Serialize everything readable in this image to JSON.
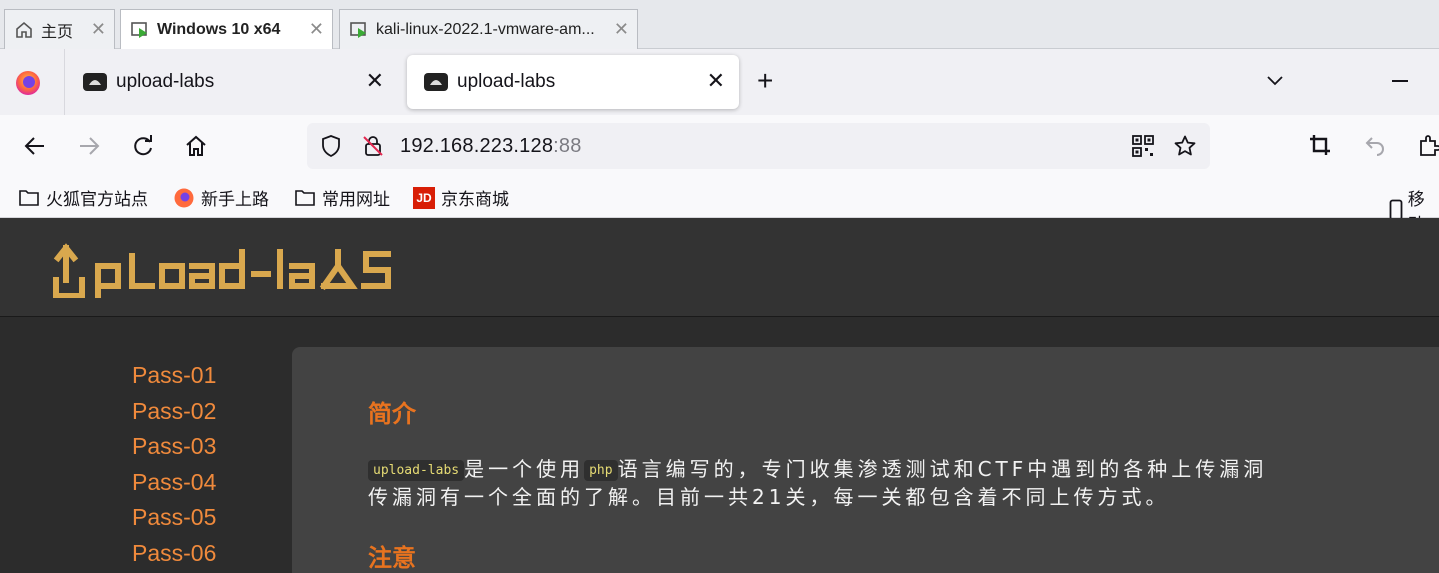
{
  "vm_tabs": [
    {
      "label": "主页"
    },
    {
      "label": "Windows 10 x64"
    },
    {
      "label": "kali-linux-2022.1-vmware-am..."
    }
  ],
  "browser_tabs": [
    {
      "label": "upload-labs"
    },
    {
      "label": "upload-labs"
    }
  ],
  "address": {
    "host": "192.168.223.128",
    "port": ":88"
  },
  "bookmarks": [
    {
      "label": "火狐官方站点",
      "icon": "folder-icon"
    },
    {
      "label": "新手上路",
      "icon": "firefox-icon"
    },
    {
      "label": "常用网址",
      "icon": "folder-icon"
    },
    {
      "label": "京东商城",
      "icon": "jd-icon"
    }
  ],
  "mobile_bookmarks": "移动",
  "jd_badge": "JD",
  "site": {
    "logo_text": "upload-labs"
  },
  "sidebar": [
    "Pass-01",
    "Pass-02",
    "Pass-03",
    "Pass-04",
    "Pass-05",
    "Pass-06"
  ],
  "content": {
    "intro_title": "简介",
    "intro_code1": "upload-labs",
    "intro_part1": "是一个使用",
    "intro_code2": "php",
    "intro_part2": "语言编写的，专门收集渗透测试和CTF中遇到的各种上传漏洞",
    "intro_line2": "传漏洞有一个全面的了解。目前一共21关，每一关都包含着不同上传方式。",
    "note_title": "注意"
  },
  "colors": {
    "accent": "#e8731f",
    "link": "#f08a3c",
    "logo": "#d9a84e",
    "code": "#e6db74"
  }
}
